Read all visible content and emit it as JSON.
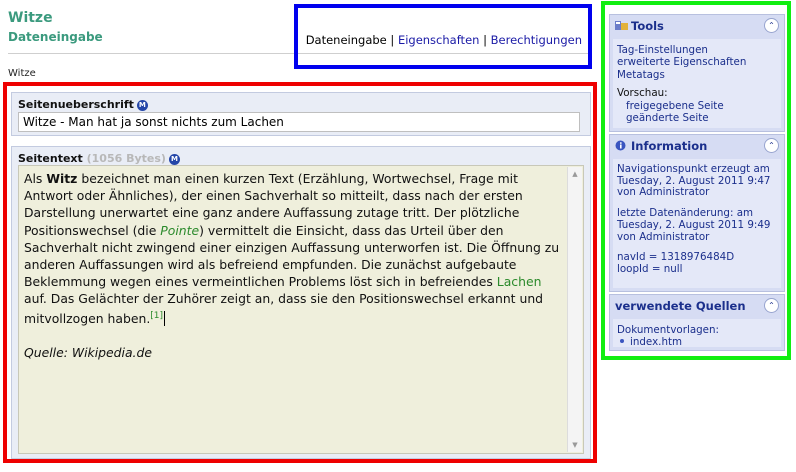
{
  "header": {
    "title": "Witze",
    "subtitle": "Dateneingabe",
    "breadcrumb": "Witze"
  },
  "nav": {
    "current": "Dateneingabe",
    "separator": "|",
    "links": [
      "Eigenschaften",
      "Berechtigungen"
    ]
  },
  "editor": {
    "heading_field": {
      "label": "Seitenueberschrift",
      "value": "Witze - Man hat ja sonst nichts zum Lachen"
    },
    "text_field": {
      "label": "Seitentext",
      "bytes": "(1056 Bytes)",
      "content": {
        "s1": "Als ",
        "s2": "Witz",
        "s3": " bezeichnet man einen kurzen Text (Erzählung, Wortwechsel, Frage mit Antwort oder Ähnliches), der einen Sachverhalt so mitteilt, dass nach der ersten Darstellung unerwartet eine ganz andere Auffassung zutage tritt. Der plötzliche Positionswechsel (die ",
        "s4": "Pointe",
        "s5": ") vermittelt die Einsicht, dass das Urteil über den Sachverhalt nicht zwingend einer einzigen Auffassung unterworfen ist. Die Öffnung zu anderen Auffassungen wird als befreiend empfunden. Die zunächst aufgebaute Beklemmung wegen eines vermeintlichen Problems löst sich in befreiendes ",
        "s6": "Lachen",
        "s7": " auf. Das Gelächter der Zuhörer zeigt an, dass sie den Positionswechsel erkannt und mitvollzogen haben.",
        "footnote": "[1]",
        "source": "Quelle: Wikipedia.de"
      }
    }
  },
  "sidebar": {
    "tools": {
      "title": "Tools",
      "links": [
        "Tag-Einstellungen",
        "erweiterte Eigenschaften",
        "Metatags"
      ],
      "preview_label": "Vorschau:",
      "preview_links": [
        "freigegebene Seite",
        "geänderte Seite"
      ]
    },
    "information": {
      "title": "Information",
      "created": [
        "Navigationspunkt erzeugt am",
        "Tuesday, 2. August 2011 9:47",
        "von Administrator"
      ],
      "modified": [
        "letzte Datenänderung: am",
        "Tuesday, 2. August 2011 9:49",
        "von Administrator"
      ],
      "ids": [
        "navId = 1318976484D",
        "loopId = null"
      ]
    },
    "sources": {
      "title": "verwendete Quellen",
      "label": "Dokumentvorlagen:",
      "items": [
        "index.htm"
      ]
    }
  },
  "colors": {
    "accent": "#3b9a7e",
    "link": "#1a1aa6",
    "panel_bg": "#d6dcf3",
    "highlight_red": "#ee0000",
    "highlight_blue": "#0000ee",
    "highlight_green": "#11ee11"
  }
}
